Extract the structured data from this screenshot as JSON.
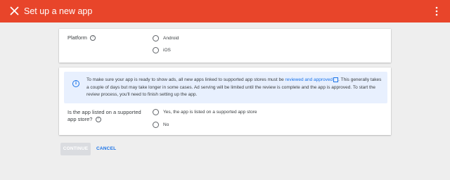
{
  "header": {
    "title": "Set up a new app",
    "close_icon": "close-icon",
    "more_icon": "more-vert-icon",
    "background_color": "#e8452a"
  },
  "platform_card": {
    "label": "Platform",
    "help_glyph": "?",
    "options": [
      {
        "label": "Android",
        "selected": false
      },
      {
        "label": "iOS",
        "selected": false
      }
    ]
  },
  "store_card": {
    "info": {
      "text_before": "To make sure your app is ready to show ads, all new apps linked to supported app stores must be ",
      "link": "reviewed and approved",
      "text_after": ". This generally takes a couple of days but may take longer in some cases. Ad serving will be limited until the review is complete and the app is approved. To start the review process, you'll need to finish setting up the app."
    },
    "question": "Is the app listed on a supported app store?",
    "help_glyph": "?",
    "options": [
      {
        "label": "Yes, the app is listed on a supported app store",
        "selected": false
      },
      {
        "label": "No",
        "selected": false
      }
    ]
  },
  "actions": {
    "continue_label": "CONTINUE",
    "cancel_label": "CANCEL",
    "accent_color": "#1a73e8"
  }
}
